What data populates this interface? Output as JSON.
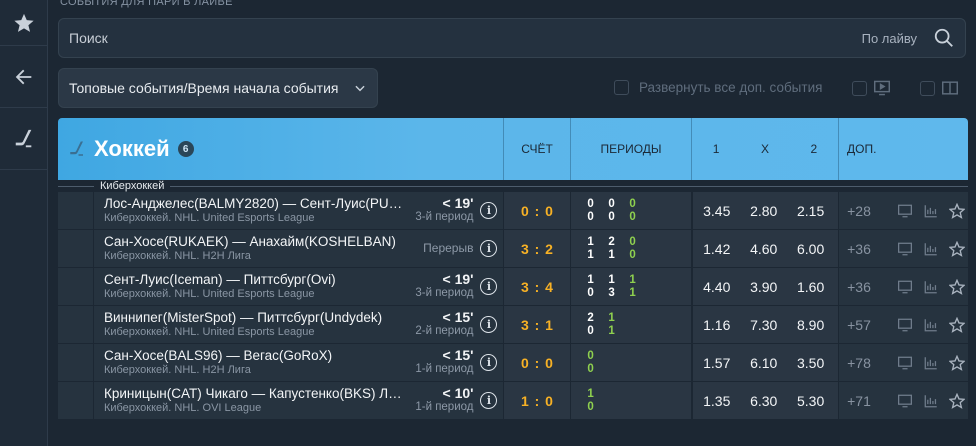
{
  "section_title": "СОБЫТИЯ ДЛЯ ПАРИ В ЛАЙВЕ",
  "search": {
    "placeholder": "Поиск",
    "mode": "По лайву"
  },
  "sort": {
    "selected": "Топовые события/Время начала события"
  },
  "expand_all_label": "Развернуть все доп. события",
  "table": {
    "sport": "Хоккей",
    "count": "6",
    "headers": {
      "score": "СЧЁТ",
      "periods": "ПЕРИОДЫ",
      "o1": "1",
      "ox": "X",
      "o2": "2",
      "extra": "ДОП."
    },
    "league_group": "Киберхоккей",
    "rows": [
      {
        "teams": "Лос-Анджелес(BALMY2820) — Сент-Луис(PU…",
        "league": "Киберхоккей. NHL. United Esports League",
        "minute": "< 19'",
        "period": "3-й период",
        "score": "0 : 0",
        "p": [
          [
            "0",
            "0",
            "0"
          ],
          [
            "0",
            "0",
            "0"
          ]
        ],
        "o1": "3.45",
        "ox": "2.80",
        "o2": "2.15",
        "more": "+28"
      },
      {
        "teams": "Сан-Хосе(RUKAEK) — Анахайм(KOSHELBAN)",
        "league": "Киберхоккей. NHL. H2H Лига",
        "minute": "",
        "period": "Перерыв",
        "score": "3 : 2",
        "p": [
          [
            "1",
            "2",
            "0"
          ],
          [
            "1",
            "1",
            "0"
          ]
        ],
        "o1": "1.42",
        "ox": "4.60",
        "o2": "6.00",
        "more": "+36"
      },
      {
        "teams": "Сент-Луис(Iceman) — Питтсбург(Ovi)",
        "league": "Киберхоккей. NHL. United Esports League",
        "minute": "< 19'",
        "period": "3-й период",
        "score": "3 : 4",
        "p": [
          [
            "1",
            "1",
            "1"
          ],
          [
            "0",
            "3",
            "1"
          ]
        ],
        "o1": "4.40",
        "ox": "3.90",
        "o2": "1.60",
        "more": "+36"
      },
      {
        "teams": "Виннипег(MisterSpot) — Питтсбург(Undydek)",
        "league": "Киберхоккей. NHL. United Esports League",
        "minute": "< 15'",
        "period": "2-й период",
        "score": "3 : 1",
        "p": [
          [
            "2",
            "1",
            ""
          ],
          [
            "0",
            "1",
            ""
          ]
        ],
        "o1": "1.16",
        "ox": "7.30",
        "o2": "8.90",
        "more": "+57"
      },
      {
        "teams": "Сан-Хосе(BALS96) — Вегас(GoRoX)",
        "league": "Киберхоккей. NHL. H2H Лига",
        "minute": "< 15'",
        "period": "1-й период",
        "score": "0 : 0",
        "p": [
          [
            "0",
            "",
            ""
          ],
          [
            "0",
            "",
            ""
          ]
        ],
        "o1": "1.57",
        "ox": "6.10",
        "o2": "3.50",
        "more": "+78"
      },
      {
        "teams": "Криницын(CAT) Чикаго — Капустенко(BKS) Л…",
        "league": "Киберхоккей. NHL. OVI League",
        "minute": "< 10'",
        "period": "1-й период",
        "score": "1 : 0",
        "p": [
          [
            "1",
            "",
            ""
          ],
          [
            "0",
            "",
            ""
          ]
        ],
        "o1": "1.35",
        "ox": "6.30",
        "o2": "5.30",
        "more": "+71"
      }
    ]
  },
  "colors": {
    "accent_header": "#5bb6ea",
    "score": "#f7b125",
    "current_period": "#8fd14f",
    "background": "#1c2733"
  }
}
